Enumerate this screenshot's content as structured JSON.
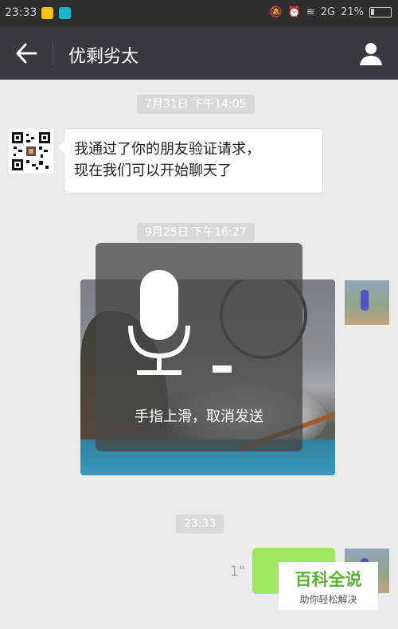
{
  "status_bar": {
    "time": "23:33",
    "network": "2G",
    "battery": "21%"
  },
  "nav": {
    "title": "优剩劣太",
    "back_icon": "arrow-left-icon",
    "profile_icon": "person-icon"
  },
  "messages": [
    {
      "type": "timestamp",
      "text": "7月31日 下午14:05"
    },
    {
      "type": "text",
      "direction": "incoming",
      "text_line1": "我通过了你的朋友验证请求，",
      "text_line2": "现在我们可以开始聊天了"
    },
    {
      "type": "timestamp",
      "text": "9月25日 下午16:27"
    },
    {
      "type": "image",
      "direction": "outgoing"
    },
    {
      "type": "timestamp",
      "text": "23:33"
    },
    {
      "type": "voice",
      "direction": "outgoing",
      "duration": "1\""
    }
  ],
  "recording_overlay": {
    "icon": "microphone-icon",
    "hint": "手指上滑，取消发送"
  },
  "watermark": {
    "title": "百科全说",
    "subtitle": "助你轻松解决"
  },
  "colors": {
    "nav_bg": "#393a3f",
    "chat_bg": "#ebebeb",
    "voice_bubble": "#9ee75e",
    "watermark_green": "#55b32e"
  }
}
